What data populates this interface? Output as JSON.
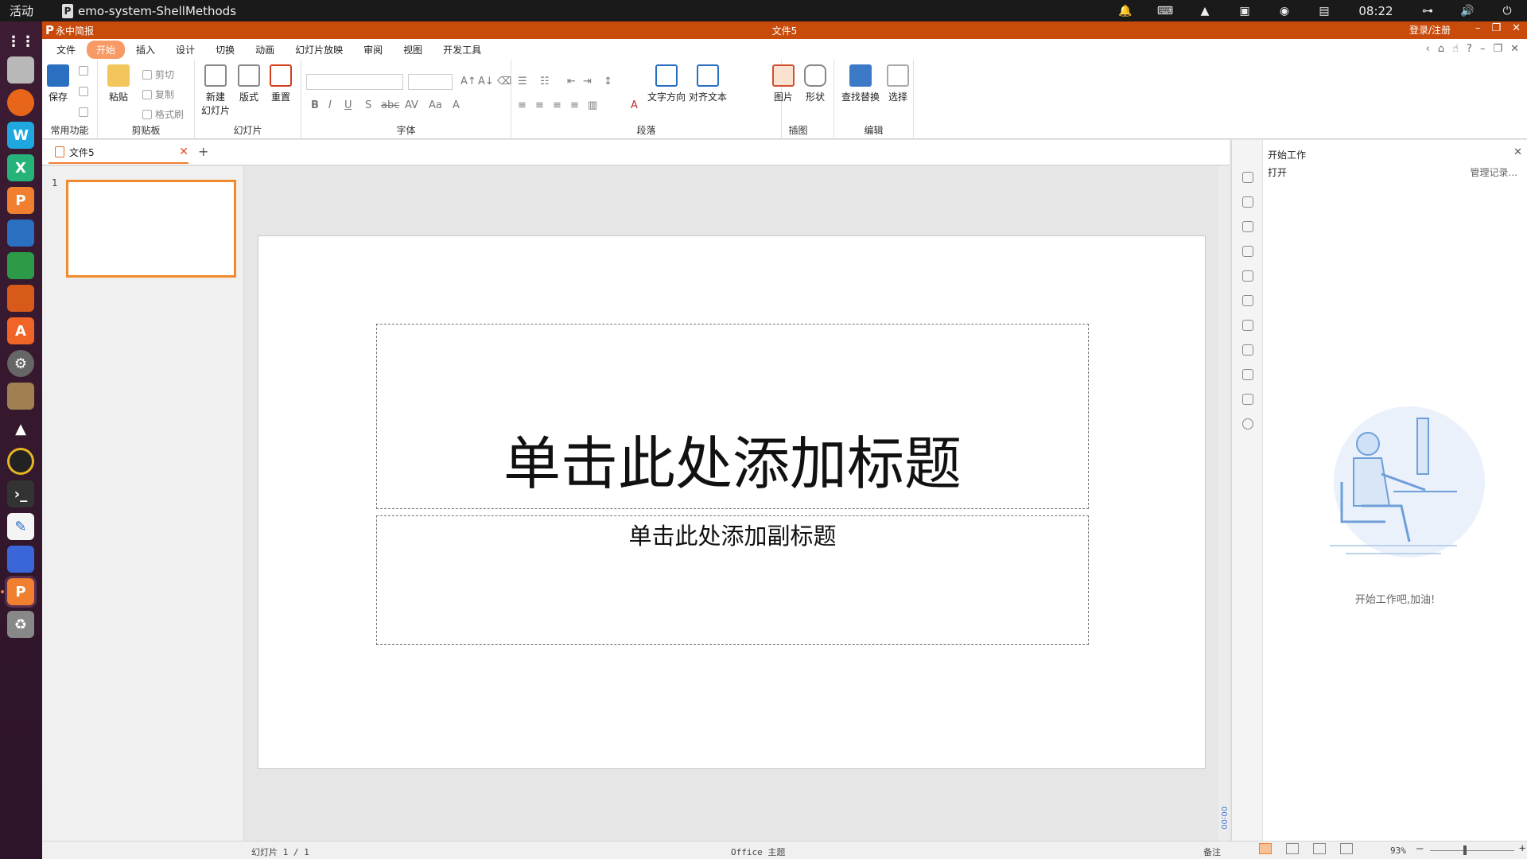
{
  "system": {
    "activities": "活动",
    "app_name": "emo-system-ShellMethods",
    "clock": "08:22"
  },
  "app": {
    "brand": "永中简报",
    "doc_title": "文件5",
    "login": "登录/注册",
    "accent": "#c94b0c"
  },
  "menu": {
    "items": [
      "文件",
      "开始",
      "插入",
      "设计",
      "切换",
      "动画",
      "幻灯片放映",
      "审阅",
      "视图",
      "开发工具"
    ],
    "active": "开始"
  },
  "ribbon": {
    "common": {
      "save": "保存",
      "label": "常用功能"
    },
    "clipboard": {
      "paste": "粘贴",
      "cut": "剪切",
      "copy": "复制",
      "format_painter": "格式刷",
      "label": "剪贴板"
    },
    "slides": {
      "new_slide_1": "新建",
      "new_slide_2": "幻灯片",
      "layout": "版式",
      "reset": "重置",
      "label": "幻灯片"
    },
    "font": {
      "label": "字体"
    },
    "paragraph": {
      "text_direction": "文字方向",
      "align_text": "对齐文本",
      "label": "段落"
    },
    "illustration": {
      "picture": "图片",
      "shape": "形状",
      "label": "插图"
    },
    "editing": {
      "find_replace": "查找替换",
      "select": "选择",
      "label": "编辑"
    }
  },
  "tab": {
    "name": "文件5"
  },
  "thumbnails": [
    {
      "number": "1"
    }
  ],
  "slide": {
    "title_placeholder": "单击此处添加标题",
    "subtitle_placeholder": "单击此处添加副标题"
  },
  "scroll_zoom_label": "00:00",
  "taskpane": {
    "title": "开始工作",
    "open": "打开",
    "manage": "管理记录...",
    "message": "开始工作吧,加油!"
  },
  "status": {
    "slides": "幻灯片 1 / 1",
    "theme": "Office 主题",
    "notes": "备注",
    "zoom": "93%"
  }
}
